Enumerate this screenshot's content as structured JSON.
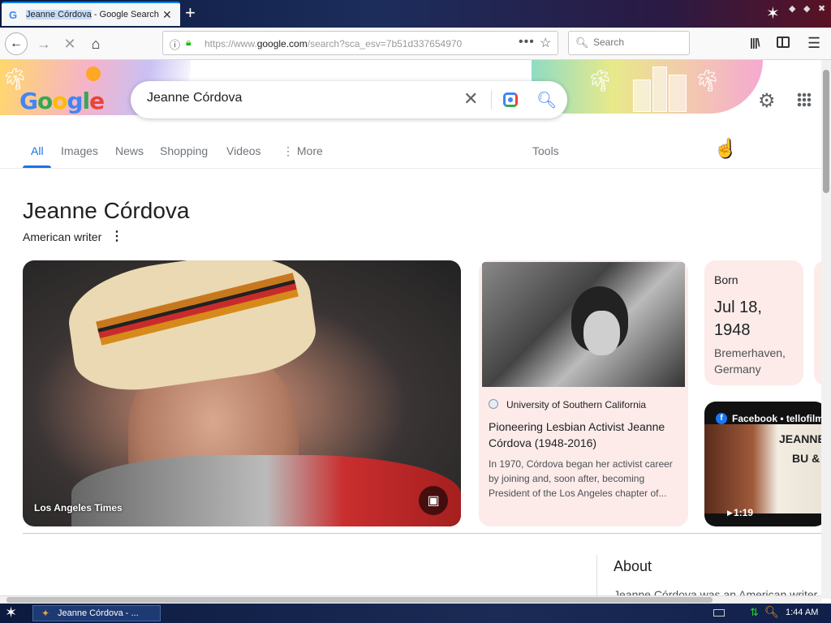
{
  "browser": {
    "tab": {
      "title_selected": "Jeanne Córdova",
      "title_rest": " - Google Search",
      "favicon": "G"
    },
    "url_host_prefix": "https://www.",
    "url_host": "google.com",
    "url_path": "/search?sca_esv=7b51d337654970",
    "search_placeholder": "Search"
  },
  "google": {
    "logo_letters": [
      "G",
      "o",
      "o",
      "g",
      "l",
      "e"
    ],
    "query": "Jeanne Córdova",
    "tabs": [
      "All",
      "Images",
      "News",
      "Shopping",
      "Videos",
      "More"
    ],
    "tools_label": "Tools"
  },
  "knowledge_panel": {
    "title": "Jeanne Córdova",
    "subtitle": "American writer",
    "main_photo_source": "Los Angeles Times",
    "article": {
      "source": "University of Southern California",
      "headline": "Pioneering Lesbian Activist Jeanne Córdova (1948-2016)",
      "snippet": "In 1970, Córdova began her activist career by joining and, soon after, becoming President of the Los Angeles chapter of..."
    },
    "born": {
      "label": "Born",
      "date": "Jul 18, 1948",
      "place": "Bremerhaven, Germany"
    },
    "video": {
      "source": "Facebook • tellofilms",
      "duration": "1:19",
      "thumb_text_1": "JEANNE",
      "thumb_text_2": "BU & I"
    },
    "about": {
      "title": "About",
      "text_partial": "Jeanne Córdova was an American writer"
    }
  },
  "taskbar": {
    "task_label": "Jeanne Córdova - ...",
    "clock": "1:44 AM"
  },
  "icons": {
    "back": "back-arrow-icon",
    "forward": "forward-arrow-icon",
    "stop": "stop-icon",
    "home": "home-icon",
    "lock": "lock-icon",
    "bookmark": "star-icon",
    "library": "library-icon",
    "menu": "hamburger-icon"
  }
}
